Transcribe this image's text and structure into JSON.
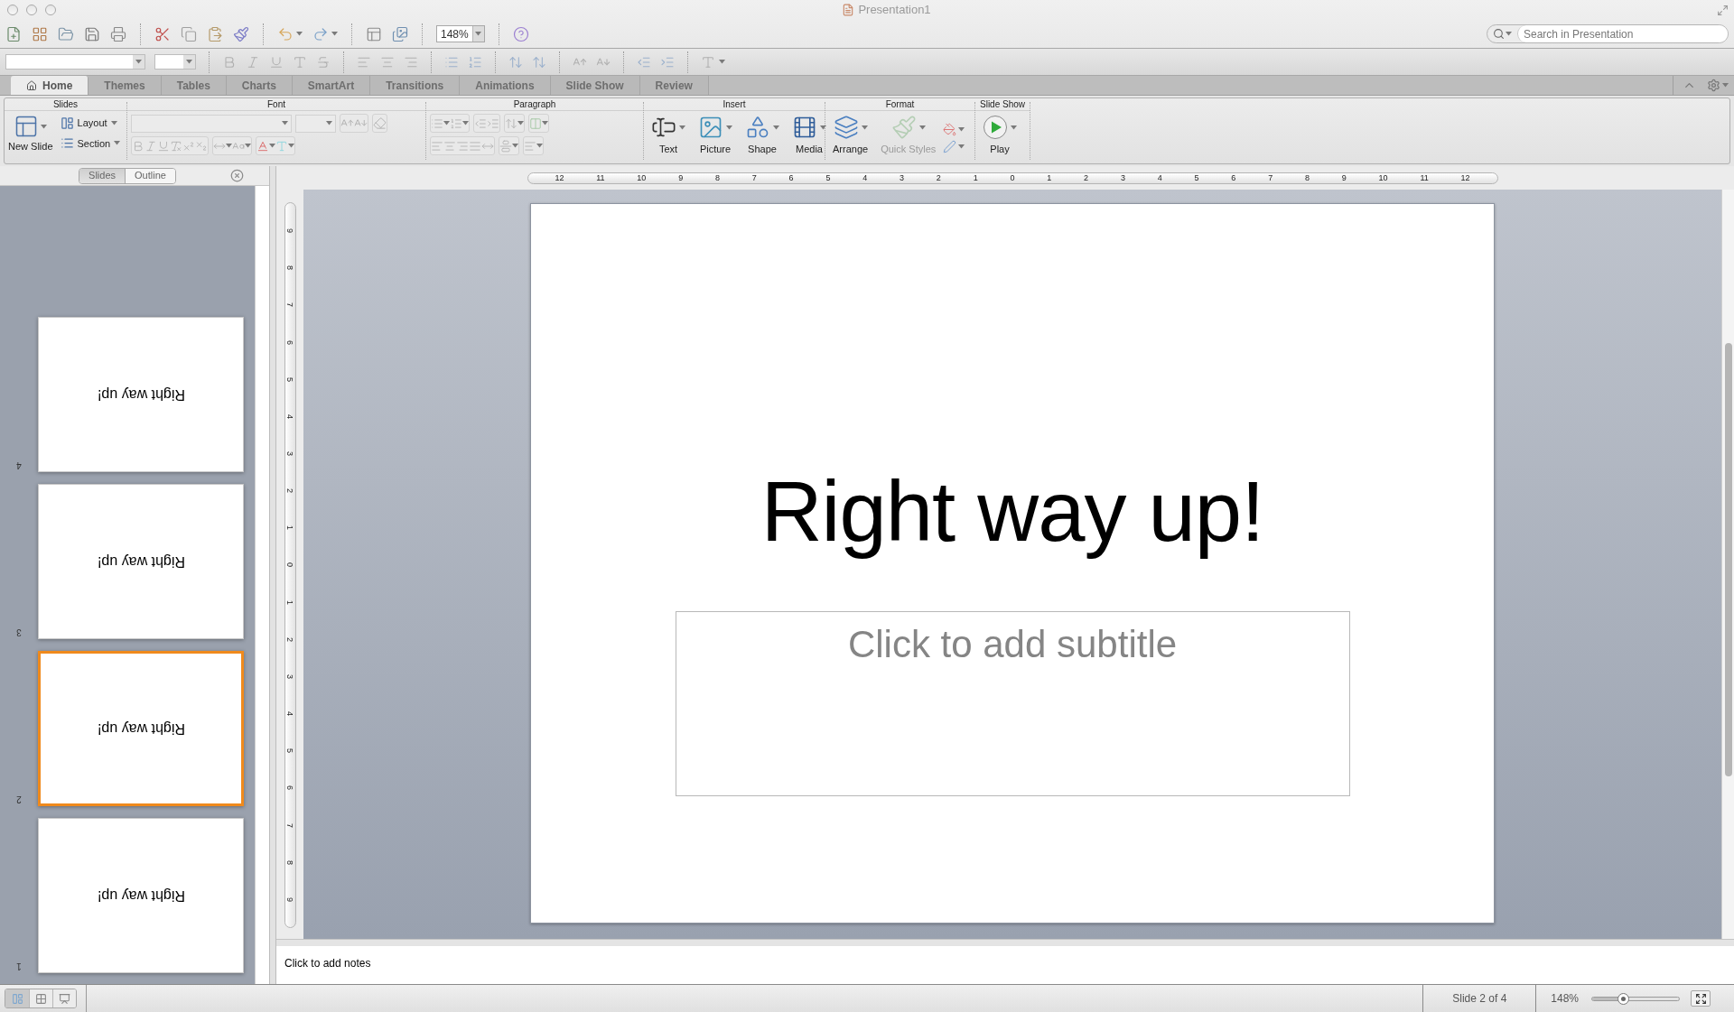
{
  "window": {
    "title": "Presentation1"
  },
  "toolbar": {
    "zoom": "148%",
    "search": {
      "placeholder": "Search in Presentation"
    }
  },
  "tabs": [
    {
      "label": "Home",
      "selected": true
    },
    {
      "label": "Themes",
      "selected": false
    },
    {
      "label": "Tables",
      "selected": false
    },
    {
      "label": "Charts",
      "selected": false
    },
    {
      "label": "SmartArt",
      "selected": false
    },
    {
      "label": "Transitions",
      "selected": false
    },
    {
      "label": "Animations",
      "selected": false
    },
    {
      "label": "Slide Show",
      "selected": false
    },
    {
      "label": "Review",
      "selected": false
    }
  ],
  "ribbon": {
    "slides_group": {
      "title": "Slides",
      "new_slide": "New Slide",
      "layout": "Layout",
      "section": "Section"
    },
    "font_group": {
      "title": "Font"
    },
    "paragraph_group": {
      "title": "Paragraph"
    },
    "insert_group": {
      "title": "Insert",
      "buttons": [
        {
          "kind": "text",
          "label": "Text",
          "disabled": false
        },
        {
          "kind": "picture",
          "label": "Picture",
          "disabled": false
        },
        {
          "kind": "shape",
          "label": "Shape",
          "disabled": false
        },
        {
          "kind": "media",
          "label": "Media",
          "disabled": false
        }
      ]
    },
    "format_group": {
      "title": "Format",
      "buttons": [
        {
          "kind": "arrange",
          "label": "Arrange",
          "disabled": false
        },
        {
          "kind": "quick_styles",
          "label": "Quick Styles",
          "disabled": true
        }
      ]
    },
    "slideshow_group": {
      "title": "Slide Show",
      "buttons": [
        {
          "kind": "play",
          "label": "Play",
          "disabled": false
        }
      ]
    }
  },
  "slide_panel": {
    "view_tabs": [
      {
        "label": "Slides",
        "selected": true
      },
      {
        "label": "Outline",
        "selected": false
      }
    ],
    "upside_down": true,
    "thumbnails": [
      {
        "number": "4",
        "title": "Right way up!",
        "selected": false
      },
      {
        "number": "3",
        "title": "Right way up!",
        "selected": false
      },
      {
        "number": "2",
        "title": "Right way up!",
        "selected": true
      },
      {
        "number": "1",
        "title": "Right way up!",
        "selected": false
      }
    ]
  },
  "rulers": {
    "horizontal": [
      "12",
      "11",
      "10",
      "9",
      "8",
      "7",
      "6",
      "5",
      "4",
      "3",
      "2",
      "1",
      "0",
      "1",
      "2",
      "3",
      "4",
      "5",
      "6",
      "7",
      "8",
      "9",
      "10",
      "11",
      "12"
    ],
    "vertical": [
      "9",
      "8",
      "7",
      "6",
      "5",
      "4",
      "3",
      "2",
      "1",
      "0",
      "1",
      "2",
      "3",
      "4",
      "5",
      "6",
      "7",
      "8",
      "9"
    ]
  },
  "slide": {
    "title": "Right way up!",
    "subtitle": {
      "placeholder": "Click to add subtitle"
    }
  },
  "notes": {
    "placeholder": "Click to add notes"
  },
  "status_bar": {
    "slide_position": "Slide 2 of 4",
    "zoom": "148%",
    "zoom_slider": {
      "level": 0.35
    }
  }
}
